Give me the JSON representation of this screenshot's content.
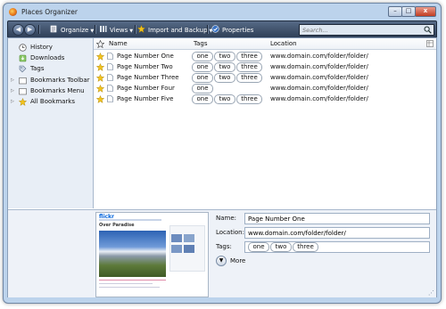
{
  "window": {
    "title": "Places Organizer",
    "controls": {
      "minimize": "–",
      "maximize": "□",
      "close": "x"
    }
  },
  "toolbar": {
    "back": "◀",
    "forward": "▶",
    "organize": "Organize",
    "views": "Views",
    "import_backup": "Import and Backup",
    "properties": "Properties",
    "search_placeholder": "Search..."
  },
  "sidebar": {
    "items": [
      {
        "label": "History",
        "icon": "history-icon"
      },
      {
        "label": "Downloads",
        "icon": "downloads-icon"
      },
      {
        "label": "Tags",
        "icon": "tags-icon"
      },
      {
        "label": "Bookmarks Toolbar",
        "icon": "folder-icon"
      },
      {
        "label": "Bookmarks Menu",
        "icon": "folder-icon"
      },
      {
        "label": "All Bookmarks",
        "icon": "star-icon"
      }
    ]
  },
  "list": {
    "columns": {
      "name": "Name",
      "tags": "Tags",
      "location": "Location"
    },
    "rows": [
      {
        "name": "Page Number One",
        "tags": [
          "one",
          "two",
          "three"
        ],
        "location": "www.domain.com/folder/folder/"
      },
      {
        "name": "Page Number Two",
        "tags": [
          "one",
          "two",
          "three"
        ],
        "location": "www.domain.com/folder/folder/"
      },
      {
        "name": "Page Number Three",
        "tags": [
          "one",
          "two",
          "three"
        ],
        "location": "www.domain.com/folder/folder/"
      },
      {
        "name": "Page Number Four",
        "tags": [
          "one"
        ],
        "location": "www.domain.com/folder/folder/"
      },
      {
        "name": "Page Number Five",
        "tags": [
          "one",
          "two",
          "three"
        ],
        "location": "www.domain.com/folder/folder/"
      }
    ]
  },
  "details": {
    "name_label": "Name:",
    "name_value": "Page Number One",
    "location_label": "Location:",
    "location_value": "www.domain.com/folder/folder/",
    "tags_label": "Tags:",
    "tags": [
      "one",
      "two",
      "three"
    ],
    "more_label": "More",
    "preview": {
      "logo": "flickr",
      "heading": "Over Paradise"
    }
  },
  "colors": {
    "star": "#f2c21b",
    "toolbar": "#2f3f57",
    "accent": "#3a73c4"
  }
}
